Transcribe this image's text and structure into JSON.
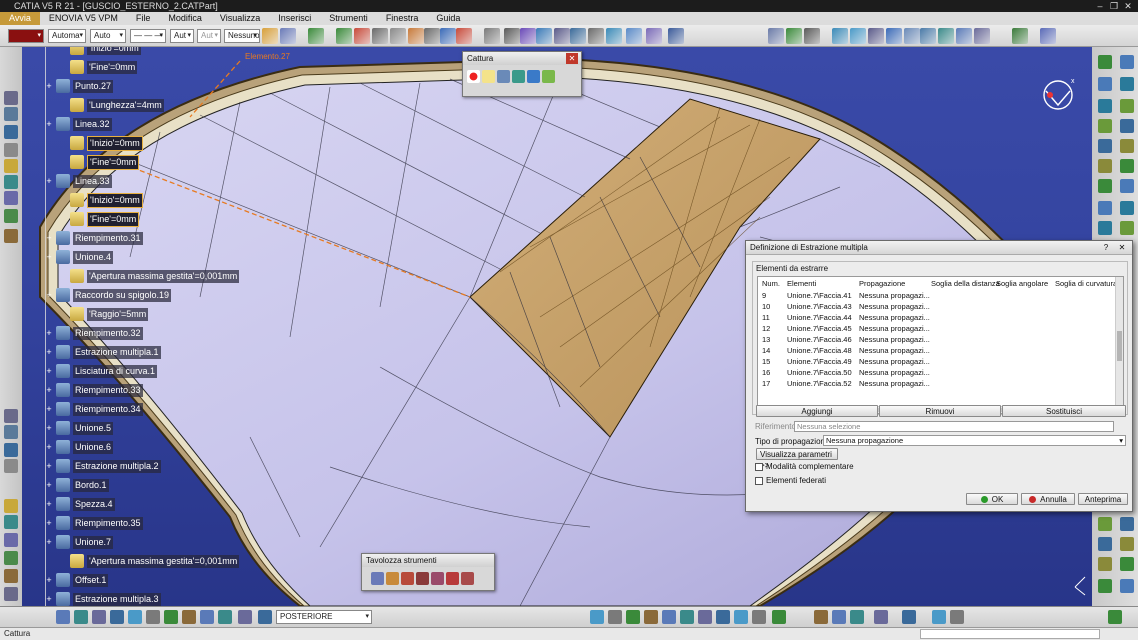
{
  "window": {
    "title": "CATIA V5 R 21 - [GUSCIO_ESTERNO_2.CATPart]"
  },
  "menu": [
    "Avvia",
    "ENOVIA V5 VPM",
    "File",
    "Modifica",
    "Visualizza",
    "Inserisci",
    "Strumenti",
    "Finestra",
    "Guida"
  ],
  "toolbar": {
    "line_type": "Automa",
    "line_weight": "Auto",
    "line_style": "— — —",
    "layer": "Aut",
    "layer2": "Aut",
    "filter": "Nessuno"
  },
  "tree": [
    {
      "label": "'Inizio'=0mm",
      "kind": "param",
      "sel": false
    },
    {
      "label": "'Fine'=0mm",
      "kind": "param",
      "sel": false
    },
    {
      "label": "Punto.27",
      "kind": "feature",
      "sel": false
    },
    {
      "label": "'Lunghezza'=4mm",
      "kind": "param",
      "sel": false
    },
    {
      "label": "Linea.32",
      "kind": "feature",
      "sel": false
    },
    {
      "label": "'Inizio'=0mm",
      "kind": "param",
      "sel": true
    },
    {
      "label": "'Fine'=0mm",
      "kind": "param",
      "sel": true
    },
    {
      "label": "Linea.33",
      "kind": "feature",
      "sel": false
    },
    {
      "label": "'Inizio'=0mm",
      "kind": "param",
      "sel": true
    },
    {
      "label": "'Fine'=0mm",
      "kind": "param",
      "sel": true
    },
    {
      "label": "Riempimento.31",
      "kind": "feature",
      "sel": false
    },
    {
      "label": "Unione.4",
      "kind": "feature",
      "sel": false
    },
    {
      "label": "'Apertura massima gestita'=0,001mm",
      "kind": "param",
      "sel": false
    },
    {
      "label": "Raccordo su spigolo.19",
      "kind": "feature",
      "sel": false
    },
    {
      "label": "'Raggio'=5mm",
      "kind": "param",
      "sel": false
    },
    {
      "label": "Riempimento.32",
      "kind": "feature",
      "sel": false
    },
    {
      "label": "Estrazione multipla.1",
      "kind": "feature",
      "sel": false
    },
    {
      "label": "Lisciatura di curva.1",
      "kind": "feature",
      "sel": false
    },
    {
      "label": "Riempimento.33",
      "kind": "feature",
      "sel": false
    },
    {
      "label": "Riempimento.34",
      "kind": "feature",
      "sel": false
    },
    {
      "label": "Unione.5",
      "kind": "feature",
      "sel": false
    },
    {
      "label": "Unione.6",
      "kind": "feature",
      "sel": false
    },
    {
      "label": "Estrazione multipla.2",
      "kind": "feature",
      "sel": false
    },
    {
      "label": "Bordo.1",
      "kind": "feature",
      "sel": false
    },
    {
      "label": "Spezza.4",
      "kind": "feature",
      "sel": false
    },
    {
      "label": "Riempimento.35",
      "kind": "feature",
      "sel": false
    },
    {
      "label": "Unione.7",
      "kind": "feature",
      "sel": false
    },
    {
      "label": "'Apertura massima gestita'=0,001mm",
      "kind": "param",
      "sel": false
    },
    {
      "label": "Offset.1",
      "kind": "feature",
      "sel": false
    },
    {
      "label": "Estrazione multipla.3",
      "kind": "feature",
      "sel": false
    }
  ],
  "viewport_label": "Elemento.27",
  "capture_toolbar": {
    "title": "Cattura"
  },
  "tool_palette": {
    "title": "Tavolozza strumenti"
  },
  "dialog": {
    "title": "Definizione di Estrazione multipla",
    "group_label": "Elementi da estrarre",
    "columns": [
      "Num.",
      "Elementi",
      "Propagazione",
      "Soglia della distanza",
      "Soglia angolare",
      "Soglia di curvatura"
    ],
    "rows": [
      {
        "num": "9",
        "elem": "Unione.7\\Faccia.41",
        "prop": "Nessuna propagazi..."
      },
      {
        "num": "10",
        "elem": "Unione.7\\Faccia.43",
        "prop": "Nessuna propagazi..."
      },
      {
        "num": "11",
        "elem": "Unione.7\\Faccia.44",
        "prop": "Nessuna propagazi..."
      },
      {
        "num": "12",
        "elem": "Unione.7\\Faccia.45",
        "prop": "Nessuna propagazi..."
      },
      {
        "num": "13",
        "elem": "Unione.7\\Faccia.46",
        "prop": "Nessuna propagazi..."
      },
      {
        "num": "14",
        "elem": "Unione.7\\Faccia.48",
        "prop": "Nessuna propagazi..."
      },
      {
        "num": "15",
        "elem": "Unione.7\\Faccia.49",
        "prop": "Nessuna propagazi..."
      },
      {
        "num": "16",
        "elem": "Unione.7\\Faccia.50",
        "prop": "Nessuna propagazi..."
      },
      {
        "num": "17",
        "elem": "Unione.7\\Faccia.52",
        "prop": "Nessuna propagazi..."
      }
    ],
    "add_label": "Aggiungi",
    "remove_label": "Rimuovi",
    "replace_label": "Sostituisci",
    "reference_label": "Riferimento:",
    "reference_placeholder": "Nessuna selezione",
    "propagation_label": "Tipo di propagazione:",
    "propagation_value": "Nessuna propagazione",
    "show_params_label": "Visualizza parametri >>",
    "complementary_label": "Modalità complementare",
    "federated_label": "Elementi federati",
    "ok_label": "OK",
    "cancel_label": "Annulla",
    "preview_label": "Anteprima"
  },
  "bottom": {
    "view_value": "POSTERIORE"
  },
  "status": {
    "text": "Cattura"
  },
  "colors": {
    "accent_tab": "#c69a3a",
    "surface": "#c9c7ec",
    "face_highlight": "#c9a46c",
    "background": "#3444a0"
  }
}
